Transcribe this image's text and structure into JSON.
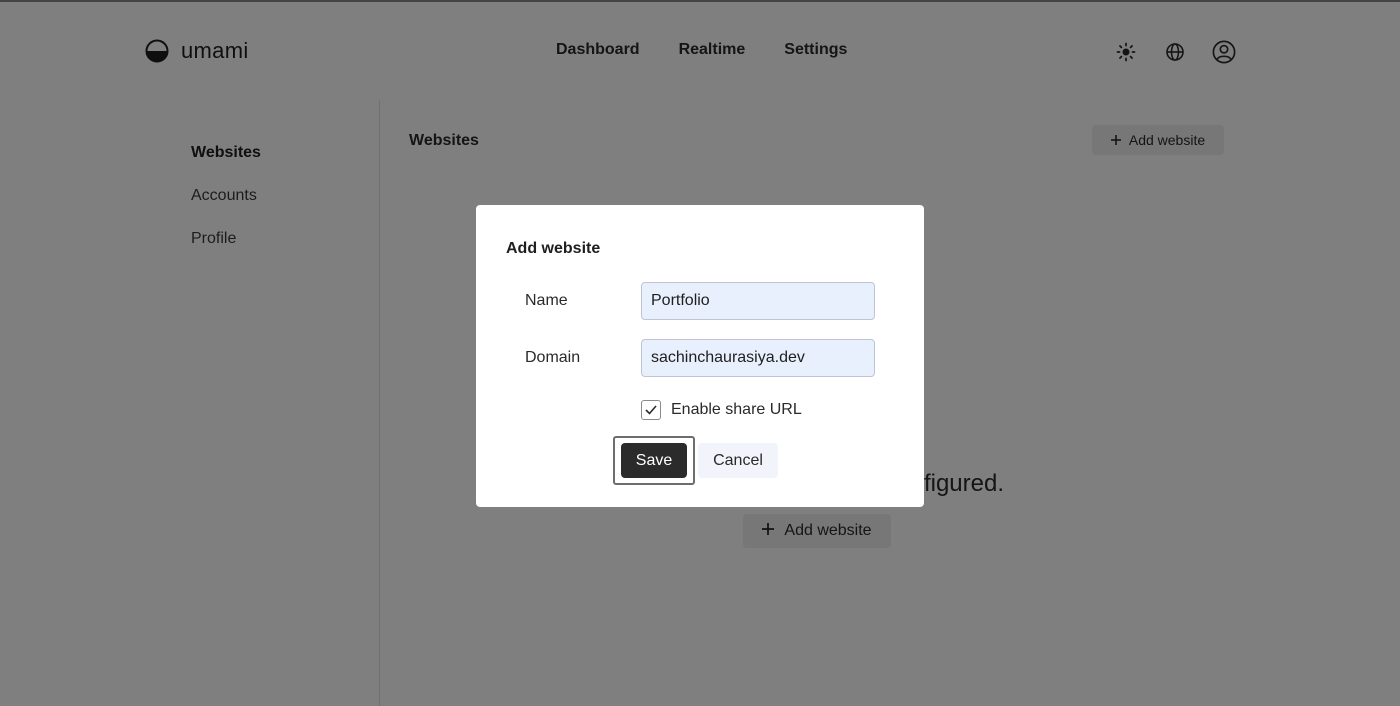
{
  "header": {
    "brand": "umami",
    "nav": [
      "Dashboard",
      "Realtime",
      "Settings"
    ],
    "icons": [
      "sun-icon",
      "globe-icon",
      "user-icon"
    ]
  },
  "sidebar": {
    "items": [
      {
        "label": "Websites",
        "active": true
      },
      {
        "label": "Accounts",
        "active": false
      },
      {
        "label": "Profile",
        "active": false
      }
    ]
  },
  "main": {
    "title": "Websites",
    "add_button": "Add website",
    "empty_text": "You don't have any websites configured.",
    "empty_add_button": "Add website"
  },
  "modal": {
    "title": "Add website",
    "name_label": "Name",
    "name_value": "Portfolio",
    "domain_label": "Domain",
    "domain_value": "sachinchaurasiya.dev",
    "share_label": "Enable share URL",
    "share_checked": true,
    "save_label": "Save",
    "cancel_label": "Cancel"
  },
  "colors": {
    "overlay": "#808080",
    "field_bg": "#e8effd",
    "save_bg": "#2b2b2b"
  }
}
